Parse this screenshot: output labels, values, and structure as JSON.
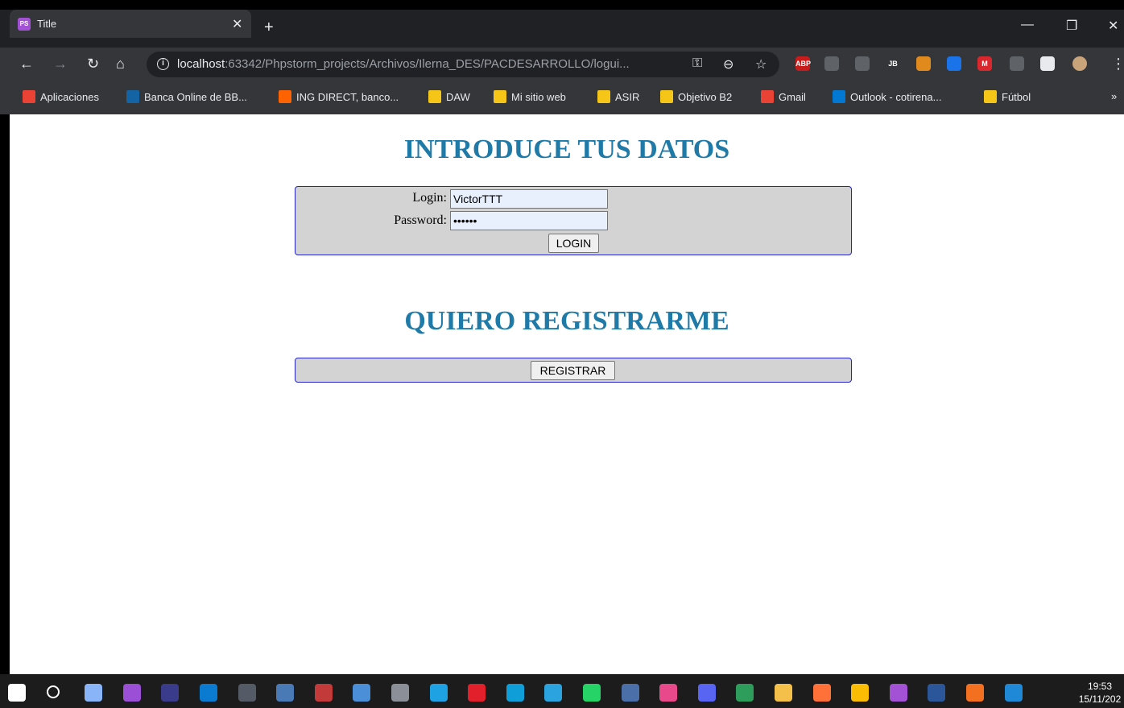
{
  "browser": {
    "tab_title": "Title",
    "tab_favicon": "PS",
    "newtab_label": "+",
    "url_host": "localhost",
    "url_rest": ":63342/Phpstorm_projects/Archivos/Ilerna_DES/PACDESARROLLO/logui...",
    "bookmarks": [
      {
        "label": "Aplicaciones",
        "icon": "apps-grid-icon"
      },
      {
        "label": "Banca Online de BB...",
        "icon": "bbva-icon"
      },
      {
        "label": "ING DIRECT, banco...",
        "icon": "ing-icon"
      },
      {
        "label": "DAW",
        "icon": "folder-icon"
      },
      {
        "label": "Mi sitio web",
        "icon": "folder-icon"
      },
      {
        "label": "ASIR",
        "icon": "folder-icon"
      },
      {
        "label": "Objetivo B2",
        "icon": "folder-icon"
      },
      {
        "label": "Gmail",
        "icon": "gmail-icon"
      },
      {
        "label": "Outlook - cotirena...",
        "icon": "outlook-icon"
      },
      {
        "label": "Fútbol",
        "icon": "folder-icon"
      }
    ],
    "bookmarks_more": "»",
    "extensions": [
      {
        "icon": "adblock-icon",
        "text": "ABP",
        "color": "#c71c1c"
      },
      {
        "icon": "printer-icon",
        "text": "",
        "color": "#5f6368"
      },
      {
        "icon": "cube-icon",
        "text": "",
        "color": "#5f6368"
      },
      {
        "icon": "jetbrains-icon",
        "text": "JB",
        "color": "#35363a"
      },
      {
        "icon": "ext-orange-icon",
        "text": "",
        "color": "#e08a1e"
      },
      {
        "icon": "feather-icon",
        "text": "",
        "color": "#1a73e8"
      },
      {
        "icon": "mega-icon",
        "text": "M",
        "color": "#d9272e"
      },
      {
        "icon": "gear-ext-icon",
        "text": "",
        "color": "#5f6368"
      },
      {
        "icon": "puzzle-icon",
        "text": "",
        "color": "#e8eaed"
      },
      {
        "icon": "profile-avatar",
        "text": "",
        "color": "#c9a47a"
      }
    ]
  },
  "page": {
    "login_heading": "INTRODUCE TUS DATOS",
    "login_label": "Login:",
    "login_value": "VictorTTT",
    "password_label": "Password:",
    "password_value": "••••••",
    "login_button": "LOGIN",
    "register_heading": "QUIERO REGISTRARME",
    "register_button": "REGISTRAR"
  },
  "taskbar": {
    "time": "19:53",
    "date": "15/11/202"
  }
}
